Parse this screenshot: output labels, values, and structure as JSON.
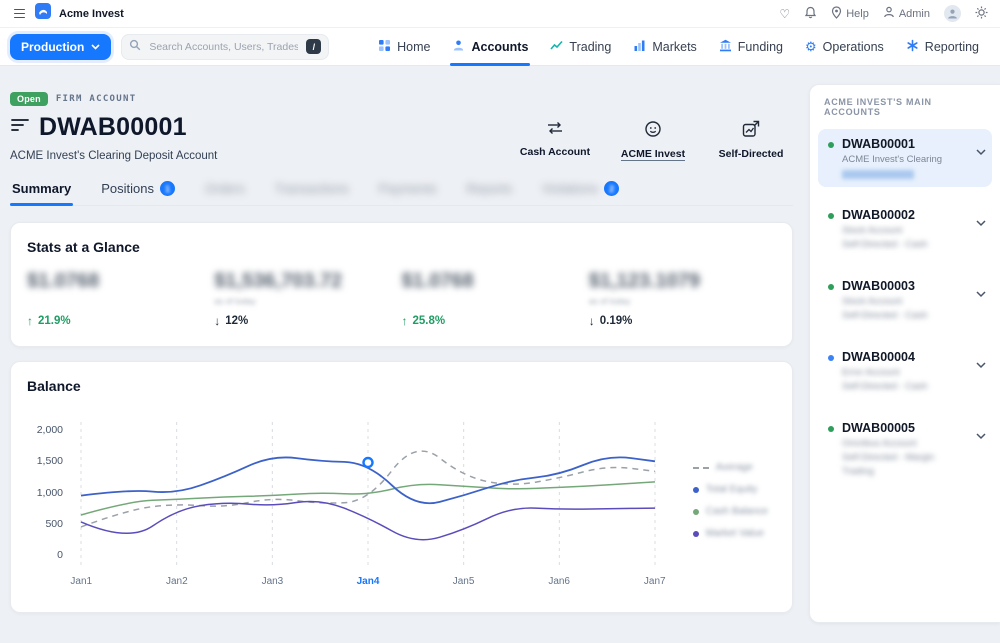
{
  "colors": {
    "accent": "#1677ff",
    "open_badge": "#3ea15f",
    "up_green": "#1f9d63",
    "down_dark": "#1f2937",
    "dot_green": "#2e9e5b",
    "dot_blue": "#3b82f6"
  },
  "topbar": {
    "brand": "Acme Invest",
    "help_label": "Help",
    "admin_label": "Admin"
  },
  "navbar": {
    "environment": "Production",
    "search_placeholder": "Search Accounts, Users, Trades...",
    "shortcut_key": "/",
    "active_item": "Accounts",
    "items": [
      {
        "label": "Home"
      },
      {
        "label": "Accounts"
      },
      {
        "label": "Trading"
      },
      {
        "label": "Markets"
      },
      {
        "label": "Funding"
      },
      {
        "label": "Operations"
      },
      {
        "label": "Reporting"
      }
    ]
  },
  "account_header": {
    "status_badge": "Open",
    "type_label": "FIRM ACCOUNT",
    "account_id": "DWAB00001",
    "description": "ACME Invest's Clearing Deposit Account",
    "actions": [
      {
        "label": "Cash Account"
      },
      {
        "label": "ACME Invest"
      },
      {
        "label": "Self-Directed"
      }
    ]
  },
  "tabs": [
    {
      "label": "Summary",
      "active": true
    },
    {
      "label": "Positions",
      "badge": "1"
    },
    {
      "label": "Orders",
      "blurred": true
    },
    {
      "label": "Transactions",
      "blurred": true
    },
    {
      "label": "Payments",
      "blurred": true
    },
    {
      "label": "Reports",
      "blurred": true
    },
    {
      "label": "Violations",
      "badge": "2",
      "blurred": true
    }
  ],
  "stats": {
    "title": "Stats at a Glance",
    "items": [
      {
        "value": "$1.0768",
        "sub": "",
        "change": "21.9%",
        "direction": "up"
      },
      {
        "value": "$1,536,703.72",
        "sub": "as of today",
        "change": "12%",
        "direction": "down"
      },
      {
        "value": "$1.0768",
        "sub": "",
        "change": "25.8%",
        "direction": "up"
      },
      {
        "value": "$1,123.1079",
        "sub": "as of today",
        "change": "0.19%",
        "direction": "down"
      }
    ]
  },
  "chart_data": {
    "type": "line",
    "title": "Balance",
    "x": [
      1,
      1.5,
      2,
      2.5,
      3,
      3.5,
      4,
      4.5,
      5,
      5.5,
      6,
      6.5,
      7
    ],
    "x_tick_labels": [
      "Jan1",
      "Jan2",
      "Jan3",
      "Jan4",
      "Jan5",
      "Jan6",
      "Jan7"
    ],
    "active_x_tick": "Jan4",
    "y_tick_labels": [
      "2,000",
      "1,500",
      "1,000",
      "500",
      "0"
    ],
    "ylim": [
      0,
      2000
    ],
    "grid": "vertical-dashed",
    "legend_position": "right",
    "legend_blurred": true,
    "series": [
      {
        "name": "Average",
        "color": "#9aa1a9",
        "style": "dashed",
        "values": [
          450,
          730,
          820,
          760,
          920,
          820,
          850,
          1850,
          1250,
          1100,
          1230,
          1430,
          1340
        ]
      },
      {
        "name": "Total Equity",
        "color": "#3c62c9",
        "style": "solid",
        "values": [
          950,
          1050,
          980,
          1250,
          1600,
          1500,
          1480,
          750,
          950,
          1200,
          1280,
          1600,
          1500
        ]
      },
      {
        "name": "Cash Balance",
        "color": "#74a878",
        "style": "solid",
        "values": [
          640,
          860,
          890,
          930,
          950,
          1000,
          960,
          1150,
          1100,
          1050,
          1080,
          1120,
          1170
        ]
      },
      {
        "name": "Market Value",
        "color": "#5a4dbb",
        "style": "solid",
        "values": [
          530,
          200,
          730,
          850,
          780,
          900,
          600,
          170,
          400,
          770,
          730,
          740,
          750
        ]
      }
    ],
    "highlight_point": {
      "series": "Total Equity",
      "x": 4,
      "value": 1480
    }
  },
  "sidebar": {
    "title": "ACME INVEST'S MAIN ACCOUNTS",
    "accounts": [
      {
        "name": "DWAB00001",
        "line1": "ACME Invest's Clearing",
        "line2": "",
        "line3": "",
        "dot": "green",
        "selected": true
      },
      {
        "name": "DWAB00002",
        "line1": "Stock Account",
        "line2": "Self-Directed - Cash",
        "line3": "",
        "dot": "green"
      },
      {
        "name": "DWAB00003",
        "line1": "Stock Account",
        "line2": "Self-Directed - Cash",
        "line3": "",
        "dot": "green"
      },
      {
        "name": "DWAB00004",
        "line1": "Error Account",
        "line2": "Self-Directed - Cash",
        "line3": "",
        "dot": "blue"
      },
      {
        "name": "DWAB00005",
        "line1": "Omnibus Account",
        "line2": "Self-Directed - Margin",
        "line3": "Trading",
        "dot": "green"
      }
    ]
  }
}
